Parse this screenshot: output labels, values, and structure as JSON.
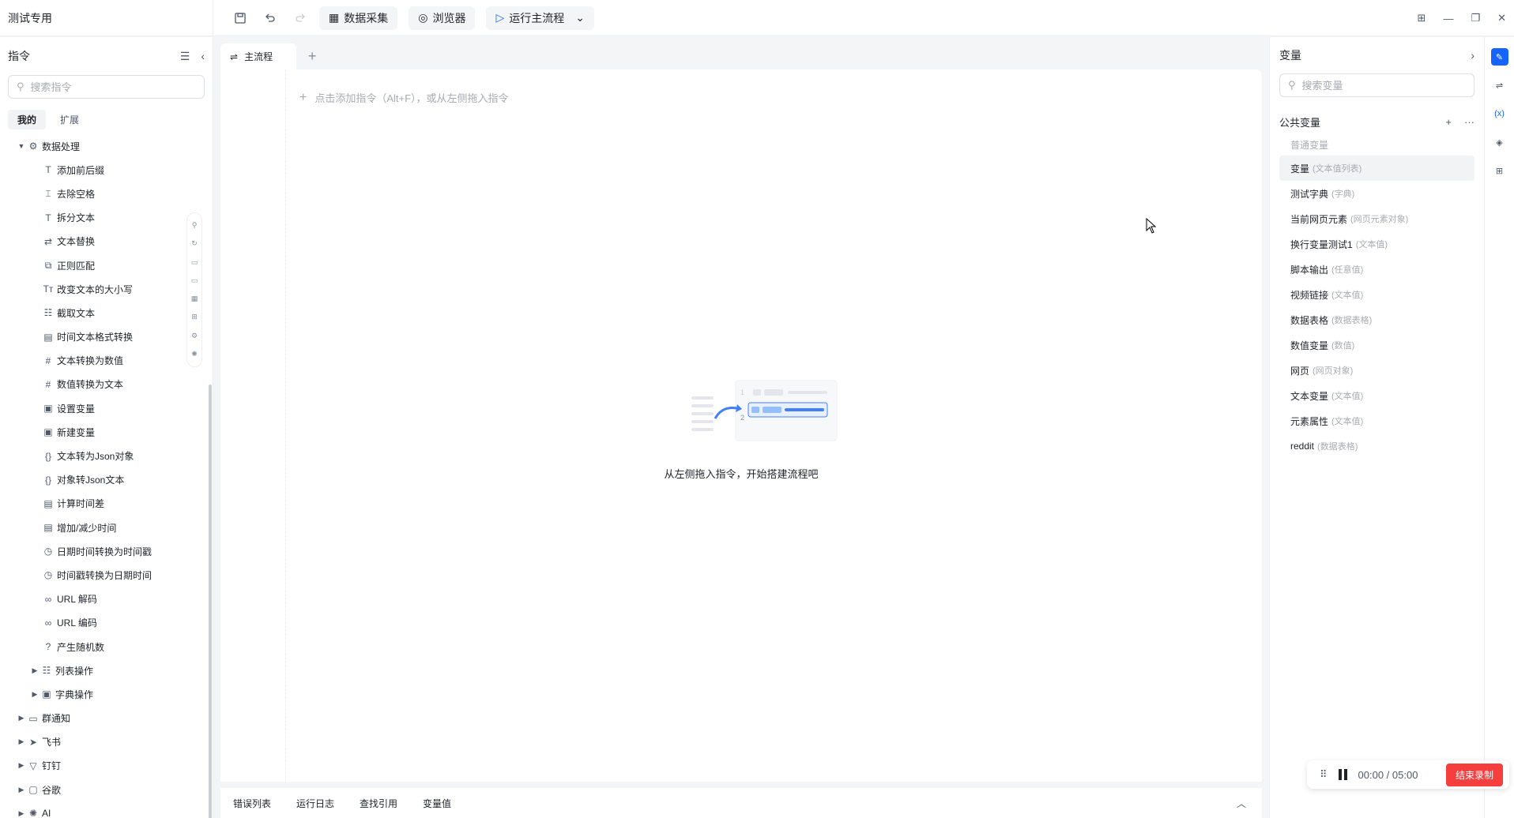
{
  "app": {
    "title": "测试专用"
  },
  "toolbar": {
    "data_collect": "数据采集",
    "browser": "浏览器",
    "run_main": "运行主流程"
  },
  "left_panel": {
    "title": "指令",
    "search_placeholder": "搜索指令",
    "tabs": [
      "我的",
      "扩展"
    ],
    "tree": {
      "group": "数据处理",
      "items": [
        "添加前后缀",
        "去除空格",
        "拆分文本",
        "文本替换",
        "正则匹配",
        "改变文本的大小写",
        "截取文本",
        "时间文本格式转换",
        "文本转换为数值",
        "数值转换为文本",
        "设置变量",
        "新建变量",
        "文本转为Json对象",
        "对象转Json文本",
        "计算时间差",
        "增加/减少时间",
        "日期时间转换为时间戳",
        "时间戳转换为日期时间",
        "URL 解码",
        "URL 编码",
        "产生随机数"
      ],
      "subgroups": [
        "列表操作",
        "字典操作"
      ],
      "groups": [
        "群通知",
        "飞书",
        "钉钉",
        "谷歌",
        "AI"
      ]
    }
  },
  "editor": {
    "tab": "主流程",
    "add_hint": "点击添加指令（Alt+F），或从左侧拖入指令",
    "empty_text": "从左侧拖入指令，开始搭建流程吧",
    "illus_nums": [
      "1",
      "2"
    ],
    "bottom_tabs": [
      "错误列表",
      "运行日志",
      "查找引用",
      "变量值"
    ]
  },
  "right_panel": {
    "title": "变量",
    "search_placeholder": "搜索变量",
    "section": "公共变量",
    "subsection": "普通变量",
    "vars": [
      {
        "name": "变量",
        "type": "(文本值列表)"
      },
      {
        "name": "测试字典",
        "type": "(字典)"
      },
      {
        "name": "当前网页元素",
        "type": "(网页元素对象)"
      },
      {
        "name": "换行变量测试1",
        "type": "(文本值)"
      },
      {
        "name": "脚本输出",
        "type": "(任意值)"
      },
      {
        "name": "视频链接",
        "type": "(文本值)"
      },
      {
        "name": "数据表格",
        "type": "(数据表格)"
      },
      {
        "name": "数值变量",
        "type": "(数值)"
      },
      {
        "name": "网页",
        "type": "(网页对象)"
      },
      {
        "name": "文本变量",
        "type": "(文本值)"
      },
      {
        "name": "元素属性",
        "type": "(文本值)"
      },
      {
        "name": "reddit",
        "type": "(数据表格)"
      }
    ]
  },
  "recording": {
    "time": "00:00 / 05:00",
    "stop": "结束录制"
  },
  "colors": {
    "accent": "#1664ff",
    "danger": "#f53f3f"
  }
}
